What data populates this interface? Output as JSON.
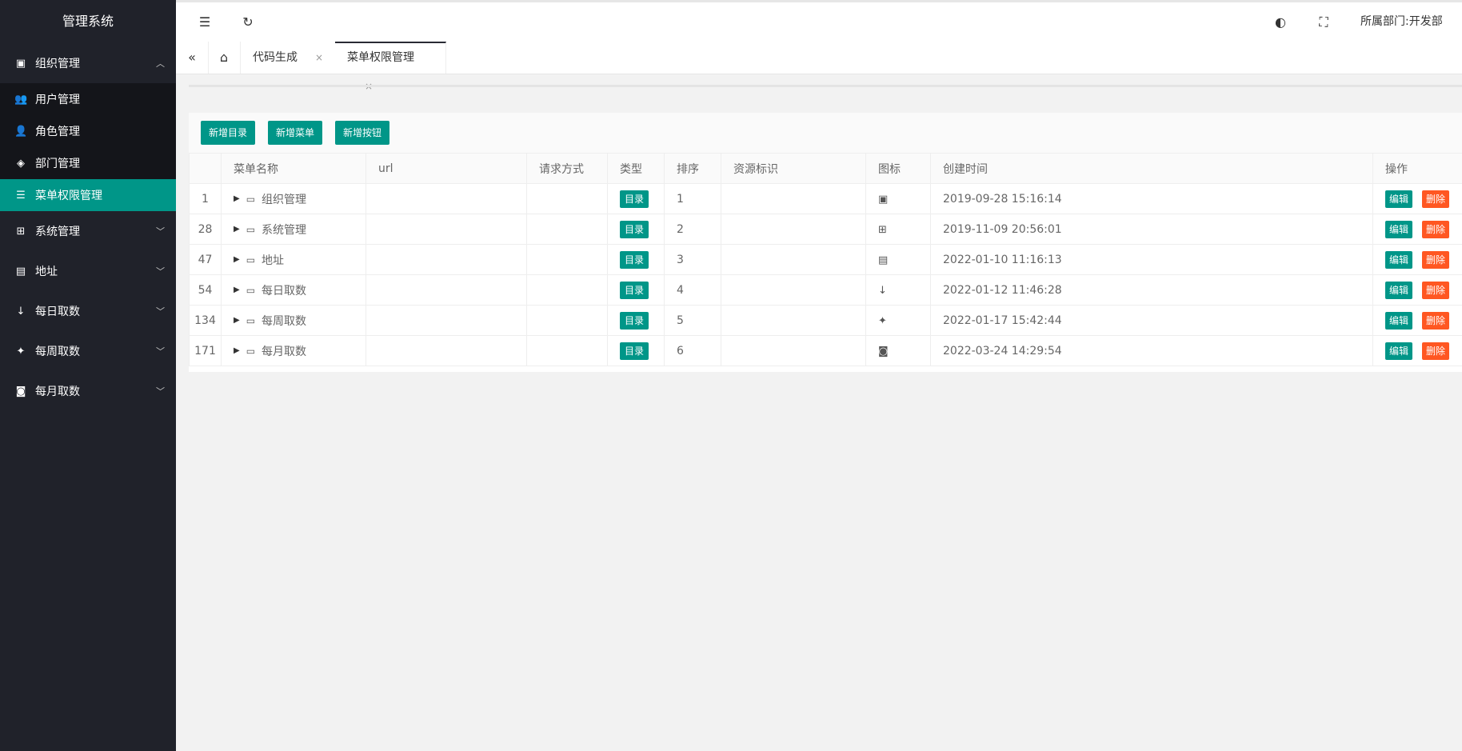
{
  "app": {
    "title": "管理系统"
  },
  "sidebar": {
    "groups": [
      {
        "label": "组织管理",
        "icon": "clipboard-icon",
        "arrow": "︿",
        "items": [
          {
            "label": "用户管理",
            "icon": "users-icon"
          },
          {
            "label": "角色管理",
            "icon": "user-group-icon"
          },
          {
            "label": "部门管理",
            "icon": "codepen-icon"
          },
          {
            "label": "菜单权限管理",
            "icon": "list-icon"
          }
        ]
      },
      {
        "label": "系统管理",
        "icon": "windows-icon",
        "arrow": "﹀"
      },
      {
        "label": "地址",
        "icon": "film-icon",
        "arrow": "﹀"
      },
      {
        "label": "每日取数",
        "icon": "sort-numeric-icon",
        "arrow": "﹀"
      },
      {
        "label": "每周取数",
        "icon": "twitter-icon",
        "arrow": "﹀"
      },
      {
        "label": "每月取数",
        "icon": "camera-icon",
        "arrow": "﹀"
      }
    ],
    "active_item": "菜单权限管理"
  },
  "header": {
    "department": "所属部门:开发部"
  },
  "tabs": [
    {
      "label": "代码生成",
      "close": "×"
    },
    {
      "label": "菜单权限管理",
      "close": "×"
    }
  ],
  "toolbar": {
    "add_dir": "新增目录",
    "add_menu": "新增菜单",
    "add_button": "新增按钮"
  },
  "table": {
    "columns": [
      "",
      "菜单名称",
      "url",
      "请求方式",
      "类型",
      "排序",
      "资源标识",
      "图标",
      "创建时间",
      "操作"
    ],
    "rows": [
      {
        "id": "1",
        "name": "组织管理",
        "url": "",
        "method": "",
        "type": "目录",
        "sort": "1",
        "perm": "",
        "icon": "clipboard-icon",
        "icon_glyph": "▣",
        "created": "2019-09-28 15:16:14"
      },
      {
        "id": "28",
        "name": "系统管理",
        "url": "",
        "method": "",
        "type": "目录",
        "sort": "2",
        "perm": "",
        "icon": "windows-icon",
        "icon_glyph": "⊞",
        "created": "2019-11-09 20:56:01"
      },
      {
        "id": "47",
        "name": "地址",
        "url": "",
        "method": "",
        "type": "目录",
        "sort": "3",
        "perm": "",
        "icon": "film-icon",
        "icon_glyph": "▤",
        "created": "2022-01-10 11:16:13"
      },
      {
        "id": "54",
        "name": "每日取数",
        "url": "",
        "method": "",
        "type": "目录",
        "sort": "4",
        "perm": "",
        "icon": "sort-numeric-icon",
        "icon_glyph": "↓",
        "created": "2022-01-12 11:46:28"
      },
      {
        "id": "134",
        "name": "每周取数",
        "url": "",
        "method": "",
        "type": "目录",
        "sort": "5",
        "perm": "",
        "icon": "twitter-icon",
        "icon_glyph": "✦",
        "created": "2022-01-17 15:42:44"
      },
      {
        "id": "171",
        "name": "每月取数",
        "url": "",
        "method": "",
        "type": "目录",
        "sort": "6",
        "perm": "",
        "icon": "camera-icon",
        "icon_glyph": "◙",
        "created": "2022-03-24 14:29:54"
      }
    ],
    "edit_label": "编辑",
    "delete_label": "删除"
  },
  "colors": {
    "sidebar_bg": "#20222a",
    "accent": "#009688",
    "danger": "#ff5722"
  }
}
